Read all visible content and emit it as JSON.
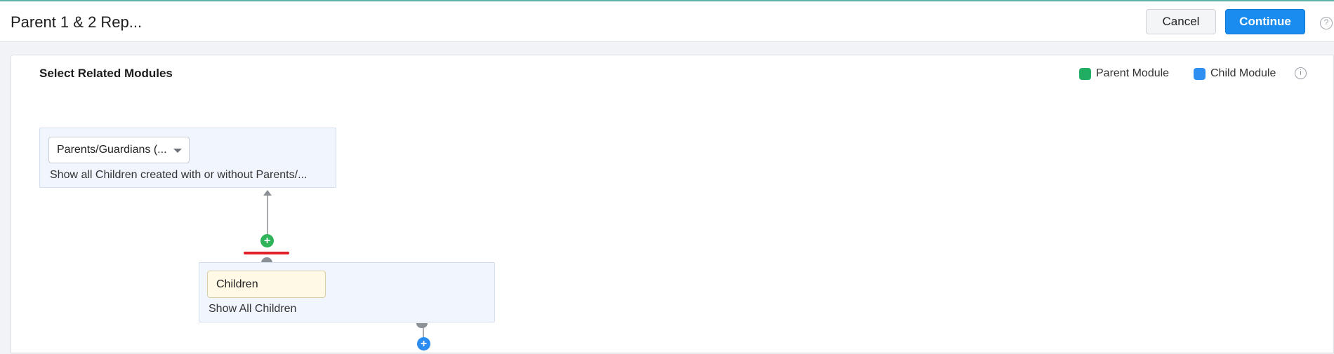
{
  "header": {
    "title": "Parent 1 & 2 Rep...",
    "cancel_label": "Cancel",
    "continue_label": "Continue",
    "help_icon": "?"
  },
  "panel": {
    "title": "Select Related Modules",
    "legend": [
      {
        "label": "Parent Module",
        "color": "#1fae62"
      },
      {
        "label": "Child Module",
        "color": "#2f8ef2"
      }
    ],
    "info_icon": "i"
  },
  "parent_node": {
    "select_value": "Parents/Guardians (...",
    "description": "Show all Children created with or without Parents/..."
  },
  "child_node": {
    "module_name": "Children",
    "description": "Show All Children"
  },
  "icons": {
    "add": "+"
  },
  "colors": {
    "primary": "#1a8cf0",
    "parent_plus": "#2fb45a",
    "child_plus": "#2a8bf0",
    "highlight": "#e0202b"
  }
}
